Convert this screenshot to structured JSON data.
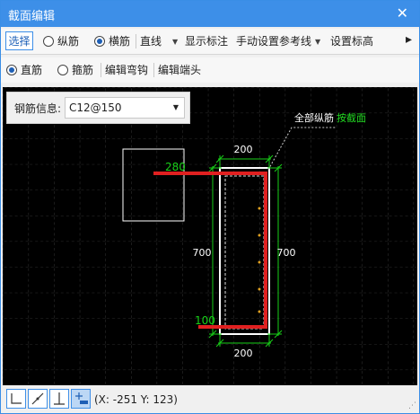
{
  "window": {
    "title": "截面编辑",
    "close_label": "✕"
  },
  "toolbar1": {
    "select_label": "选择",
    "longitudinal_label": "纵筋",
    "transverse_label": "横筋",
    "line_type_value": "直线",
    "show_annotation_label": "显示标注",
    "manual_ref_line_label": "手动设置参考线",
    "set_elevation_label": "设置标高",
    "more_label": "▸"
  },
  "toolbar2": {
    "straight_bar_label": "直筋",
    "stirrup_label": "箍筋",
    "edit_hook_label": "编辑弯钩",
    "edit_end_label": "编辑端头"
  },
  "rebar_info": {
    "label": "钢筋信息:",
    "value": "C12@150"
  },
  "drawing": {
    "dim_top": "200",
    "dim_bottom": "200",
    "dim_left": "700",
    "dim_right": "700",
    "rebar_top_length": "280",
    "rebar_bottom_length": "100",
    "note_prefix": "全部纵筋",
    "note_suffix": "按截面",
    "colors": {
      "background": "#000000",
      "rebar": "#e02020",
      "dimension": "#18d018",
      "outline": "#ffffff",
      "grid": "#5a5a5a",
      "note": "#22dd22"
    }
  },
  "status": {
    "coordinates": "(X: -251 Y: 123)"
  }
}
